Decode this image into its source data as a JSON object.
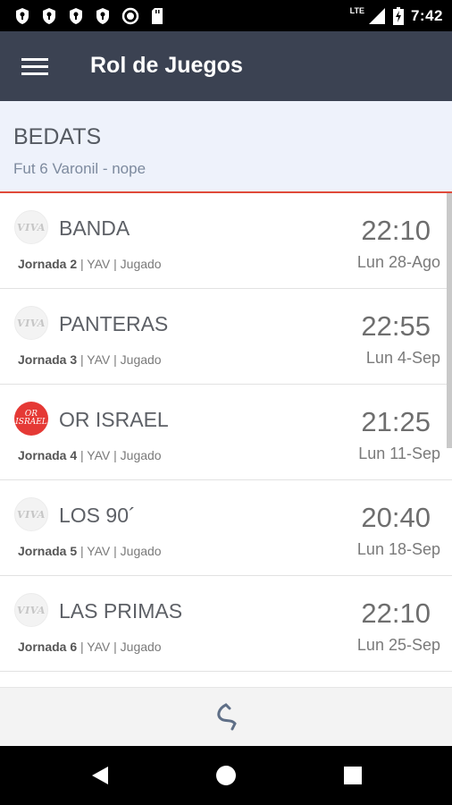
{
  "status_bar": {
    "time": "7:42",
    "network": "LTE",
    "notification_icons": [
      "shield-icon",
      "shield-icon",
      "shield-icon",
      "shield-icon",
      "record-icon",
      "sd-card-icon"
    ],
    "system_icons": [
      "signal-icon",
      "battery-charging-icon"
    ]
  },
  "app_bar": {
    "title": "Rol de Juegos",
    "menu_icon": "hamburger-menu-icon",
    "color": "#3b4252"
  },
  "team": {
    "name": "BEDATS",
    "subtitle": "Fut 6 Varonil - nope",
    "accent_color": "#e04a3a"
  },
  "games": [
    {
      "logo": "VIVA",
      "logo_type": "viva",
      "opponent": "BANDA",
      "jornada": "Jornada 2",
      "meta": " | YAV | Jugado",
      "time": "22:10",
      "date": "Lun 28-Ago"
    },
    {
      "logo": "VIVA",
      "logo_type": "viva",
      "opponent": "PANTERAS",
      "jornada": "Jornada 3",
      "meta": " | YAV | Jugado",
      "time": "22:55",
      "date": "Lun 4-Sep"
    },
    {
      "logo": "OR ISRAEL",
      "logo_type": "red",
      "opponent": "OR ISRAEL",
      "jornada": "Jornada 4",
      "meta": " | YAV | Jugado",
      "time": "21:25",
      "date": "Lun 11-Sep"
    },
    {
      "logo": "VIVA",
      "logo_type": "viva",
      "opponent": "LOS 90´",
      "jornada": "Jornada 5",
      "meta": " | YAV | Jugado",
      "time": "20:40",
      "date": "Lun 18-Sep"
    },
    {
      "logo": "VIVA",
      "logo_type": "viva",
      "opponent": "LAS PRIMAS",
      "jornada": "Jornada 6",
      "meta": " | YAV | Jugado",
      "time": "22:10",
      "date": "Lun 25-Sep"
    }
  ],
  "footer": {
    "icon": "brand-logo-icon"
  },
  "nav_bar": {
    "buttons": [
      "back-icon",
      "home-icon",
      "recents-icon"
    ]
  }
}
